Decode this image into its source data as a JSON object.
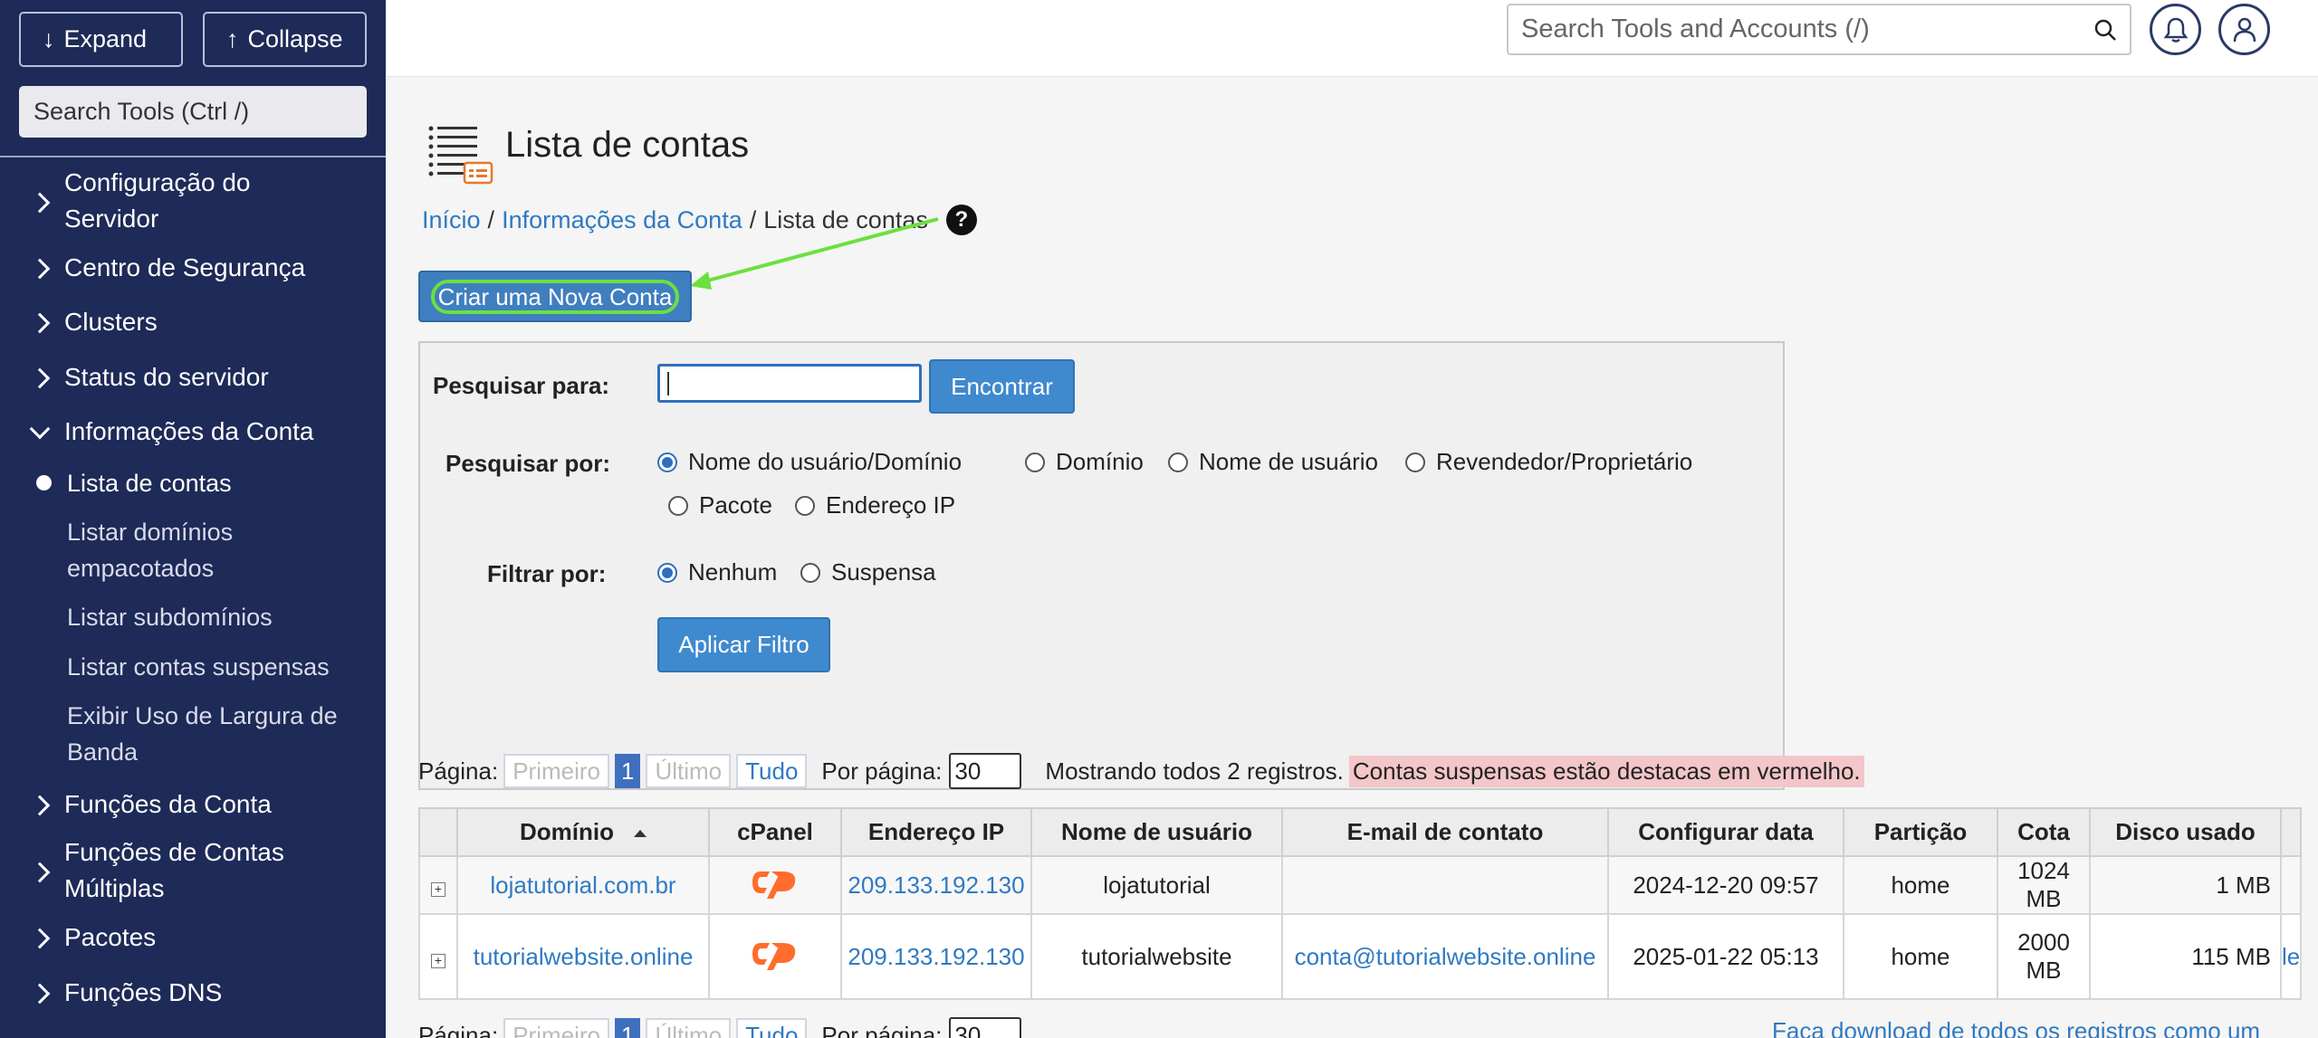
{
  "sidebar": {
    "expand_label": "Expand",
    "collapse_label": "Collapse",
    "search_placeholder": "Search Tools (Ctrl /)",
    "items": [
      {
        "label": "Configuração do Servidor"
      },
      {
        "label": "Centro de Segurança"
      },
      {
        "label": "Clusters"
      },
      {
        "label": "Status do servidor"
      },
      {
        "label": "Informações da Conta"
      },
      {
        "label": "Funções da Conta"
      },
      {
        "label": "Funções de Contas Múltiplas"
      },
      {
        "label": "Pacotes"
      },
      {
        "label": "Funções DNS"
      }
    ],
    "subitems": [
      {
        "label": "Lista de contas"
      },
      {
        "label": "Listar domínios empacotados"
      },
      {
        "label": "Listar subdomínios"
      },
      {
        "label": "Listar contas suspensas"
      },
      {
        "label": "Exibir Uso de Largura de Banda"
      }
    ]
  },
  "header": {
    "search_placeholder": "Search Tools and Accounts (/)"
  },
  "page": {
    "title": "Lista de contas",
    "breadcrumb": [
      "Início",
      "Informações da Conta",
      "Lista de contas"
    ],
    "breadcrumb_sep": "/",
    "create_button": "Criar uma Nova Conta",
    "help": "?"
  },
  "search": {
    "search_for_label": "Pesquisar para:",
    "find_button": "Encontrar",
    "search_by_label": "Pesquisar por:",
    "search_by_options": [
      "Nome do usuário/Domínio",
      "Domínio",
      "Nome de usuário",
      "Revendedor/Proprietário",
      "Pacote",
      "Endereço IP"
    ],
    "filter_by_label": "Filtrar por:",
    "filter_options": [
      "Nenhum",
      "Suspensa"
    ],
    "apply_button": "Aplicar Filtro"
  },
  "pager": {
    "page_label": "Página:",
    "first": "Primeiro",
    "current": "1",
    "last": "Último",
    "all": "Tudo",
    "per_page_label": "Por página:",
    "per_page_value": "30",
    "showing": "Mostrando todos 2 registros.",
    "suspended_note": "Contas suspensas estão destacas em vermelho.",
    "download": "Faça download de todos os registros como um arqui"
  },
  "table": {
    "columns": [
      "Domínio",
      "cPanel",
      "Endereço IP",
      "Nome de usuário",
      "E-mail de contato",
      "Configurar data",
      "Partição",
      "Cota",
      "Disco usado"
    ],
    "rows": [
      {
        "domain": "lojatutorial.com.br",
        "ip": "209.133.192.130",
        "user": "lojatutorial",
        "email": "",
        "date": "2024-12-20 09:57",
        "partition": "home",
        "quota": "1024 MB",
        "disk": "1 MB",
        "extra": ""
      },
      {
        "domain": "tutorialwebsite.online",
        "ip": "209.133.192.130",
        "user": "tutorialwebsite",
        "email": "conta@tutorialwebsite.online",
        "date": "2025-01-22 05:13",
        "partition": "home",
        "quota": "2000 MB",
        "disk": "115 MB",
        "extra": "le"
      }
    ]
  },
  "colors": {
    "sidebar_bg": "#1e2a57",
    "accent": "#3f89cf",
    "link": "#2f7ac2",
    "highlight_green": "#6be03e",
    "notice_bg": "#f3c6c9",
    "cpanel_orange": "#ff6c2c"
  }
}
